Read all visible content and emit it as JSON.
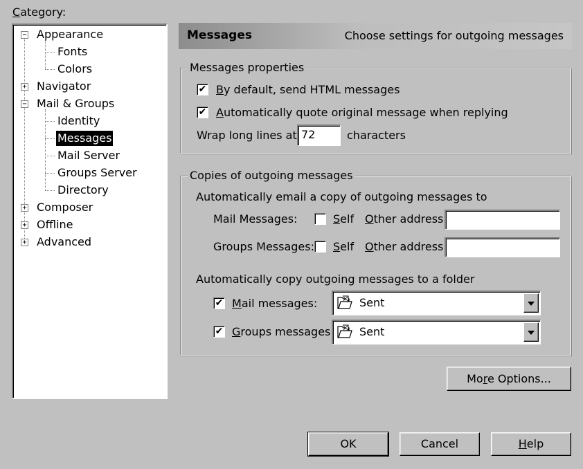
{
  "category": {
    "label": "Category:",
    "items": [
      {
        "label": "Appearance",
        "toggle": "−"
      },
      {
        "label": "Fonts"
      },
      {
        "label": "Colors"
      },
      {
        "label": "Navigator",
        "toggle": "+"
      },
      {
        "label": "Mail & Groups",
        "toggle": "−"
      },
      {
        "label": "Identity"
      },
      {
        "label": "Messages",
        "selected": true
      },
      {
        "label": "Mail Server"
      },
      {
        "label": "Groups Server"
      },
      {
        "label": "Directory"
      },
      {
        "label": "Composer",
        "toggle": "+"
      },
      {
        "label": "Offline",
        "toggle": "+"
      },
      {
        "label": "Advanced",
        "toggle": "+"
      }
    ]
  },
  "header": {
    "title": "Messages",
    "description": "Choose settings for outgoing messages"
  },
  "properties": {
    "legend": "Messages properties",
    "send_html": {
      "label": "By default, send HTML messages",
      "checked": true
    },
    "quote_original": {
      "label": "Automatically quote original message when replying",
      "checked": true
    },
    "wrap_label": "Wrap long lines at",
    "wrap_value": "72",
    "wrap_suffix": "characters"
  },
  "copies": {
    "legend": "Copies of outgoing messages",
    "email_heading": "Automatically email a copy of outgoing messages to",
    "mail_label": "Mail Messages:",
    "groups_label": "Groups Messages:",
    "self_label": "Self",
    "other_label": "Other address:",
    "mail_self_checked": false,
    "groups_self_checked": false,
    "mail_other_value": "",
    "groups_other_value": "",
    "folder_heading": "Automatically copy outgoing messages to a folder",
    "mail_folder_label": "Mail messages:",
    "groups_folder_label": "Groups messages:",
    "mail_folder_checked": true,
    "groups_folder_checked": true,
    "mail_folder_value": "Sent",
    "groups_folder_value": "Sent"
  },
  "buttons": {
    "more_options": "More Options...",
    "ok": "OK",
    "cancel": "Cancel",
    "help": "Help"
  },
  "icons": {
    "checkmark": "✔",
    "folder": "folder-icon",
    "dropdown": "chevron-down-icon"
  }
}
